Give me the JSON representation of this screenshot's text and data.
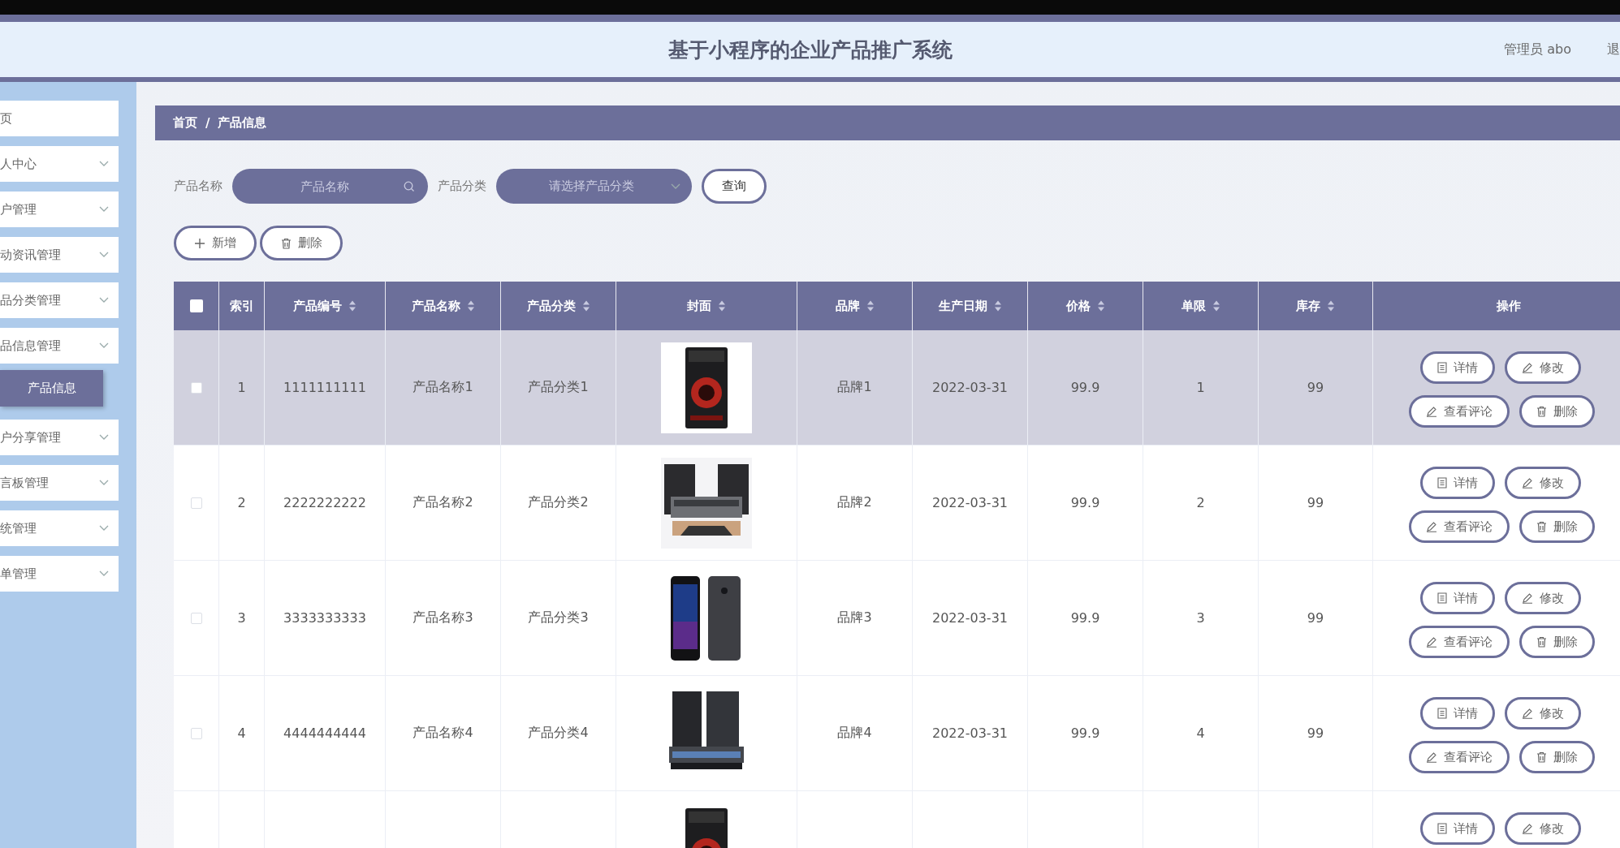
{
  "header": {
    "title": "基于小程序的企业产品推广系统",
    "user": "管理员 abo",
    "logout": "退"
  },
  "sidebar": {
    "items": [
      {
        "label": "页",
        "expandable": false
      },
      {
        "label": "人中心",
        "expandable": true
      },
      {
        "label": "户管理",
        "expandable": true
      },
      {
        "label": "动资讯管理",
        "expandable": true
      },
      {
        "label": "品分类管理",
        "expandable": true
      },
      {
        "label": "品信息管理",
        "expandable": true,
        "children": [
          {
            "label": "产品信息",
            "selected": true
          }
        ]
      },
      {
        "label": "户分享管理",
        "expandable": true
      },
      {
        "label": "言板管理",
        "expandable": true
      },
      {
        "label": "统管理",
        "expandable": true
      },
      {
        "label": "单管理",
        "expandable": true
      }
    ]
  },
  "breadcrumb": {
    "items": [
      "首页",
      "产品信息"
    ],
    "separator": "/"
  },
  "search": {
    "fields": [
      {
        "label": "产品名称",
        "placeholder": "产品名称",
        "kind": "text"
      },
      {
        "label": "产品分类",
        "placeholder": "请选择产品分类",
        "kind": "select"
      }
    ],
    "button": "查询"
  },
  "actions": [
    {
      "label": "新增",
      "kind": "add"
    },
    {
      "label": "删除",
      "kind": "delete"
    }
  ],
  "table": {
    "select_all_checked": false,
    "columns": [
      {
        "label": "索引",
        "sortable": false
      },
      {
        "label": "产品编号",
        "sortable": true
      },
      {
        "label": "产品名称",
        "sortable": true
      },
      {
        "label": "产品分类",
        "sortable": true
      },
      {
        "label": "封面",
        "sortable": true
      },
      {
        "label": "品牌",
        "sortable": true
      },
      {
        "label": "生产日期",
        "sortable": true
      },
      {
        "label": "价格",
        "sortable": true
      },
      {
        "label": "单限",
        "sortable": true
      },
      {
        "label": "库存",
        "sortable": true
      },
      {
        "label": "操作",
        "sortable": false
      }
    ],
    "rows": [
      {
        "checked": false,
        "highlighted": true,
        "cells": [
          "1",
          "1111111111",
          "产品名称1",
          "产品分类1",
          null,
          "品牌1",
          "2022-03-31",
          "99.9",
          "1",
          "99"
        ],
        "actions": [
          {
            "label": "详情",
            "kind": "detail"
          },
          {
            "label": "修改",
            "kind": "edit"
          },
          {
            "label": "查看评论",
            "kind": "comment"
          },
          {
            "label": "删除",
            "kind": "delete"
          }
        ]
      },
      {
        "checked": false,
        "highlighted": false,
        "cells": [
          "2",
          "2222222222",
          "产品名称2",
          "产品分类2",
          null,
          "品牌2",
          "2022-03-31",
          "99.9",
          "2",
          "99"
        ],
        "actions": [
          {
            "label": "详情",
            "kind": "detail"
          },
          {
            "label": "修改",
            "kind": "edit"
          },
          {
            "label": "查看评论",
            "kind": "comment"
          },
          {
            "label": "删除",
            "kind": "delete"
          }
        ]
      },
      {
        "checked": false,
        "highlighted": false,
        "cells": [
          "3",
          "3333333333",
          "产品名称3",
          "产品分类3",
          null,
          "品牌3",
          "2022-03-31",
          "99.9",
          "3",
          "99"
        ],
        "actions": [
          {
            "label": "详情",
            "kind": "detail"
          },
          {
            "label": "修改",
            "kind": "edit"
          },
          {
            "label": "查看评论",
            "kind": "comment"
          },
          {
            "label": "删除",
            "kind": "delete"
          }
        ]
      },
      {
        "checked": false,
        "highlighted": false,
        "cells": [
          "4",
          "4444444444",
          "产品名称4",
          "产品分类4",
          null,
          "品牌4",
          "2022-03-31",
          "99.9",
          "4",
          "99"
        ],
        "actions": [
          {
            "label": "详情",
            "kind": "detail"
          },
          {
            "label": "修改",
            "kind": "edit"
          },
          {
            "label": "查看评论",
            "kind": "comment"
          },
          {
            "label": "删除",
            "kind": "delete"
          }
        ]
      },
      {
        "highlighted": false,
        "actions": [
          {
            "label": "详情",
            "kind": "detail"
          },
          {
            "label": "修改",
            "kind": "edit"
          }
        ]
      }
    ]
  }
}
